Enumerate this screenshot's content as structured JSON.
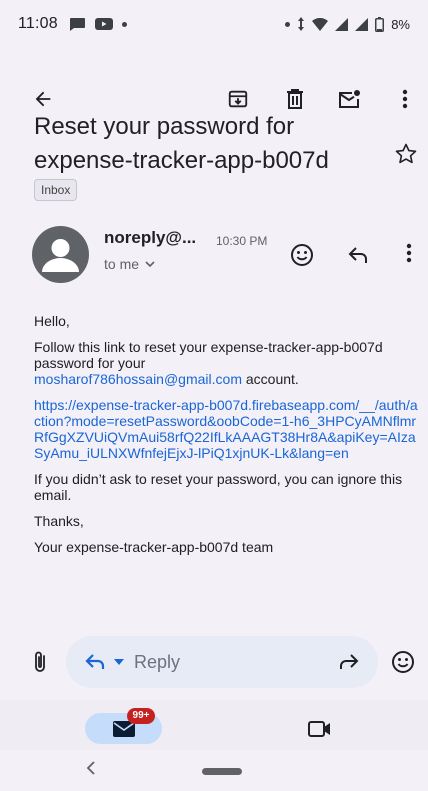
{
  "status_bar": {
    "time": "11:08",
    "battery": "8%",
    "icons": [
      "chat-bubble-icon",
      "youtube-icon",
      "dot-icon",
      "dot-icon",
      "data-arrows-icon",
      "wifi-icon",
      "signal-icon",
      "signal-icon",
      "battery-icon"
    ]
  },
  "toolbar": {
    "icons": [
      "back-arrow-icon",
      "archive-icon",
      "delete-icon",
      "mark-unread-icon",
      "more-vert-icon"
    ]
  },
  "email": {
    "subject": "Reset your password for expense-tracker-app-b007d",
    "label": "Inbox",
    "sender": "noreply@...",
    "time": "10:30 PM",
    "to": "to me",
    "greeting": "Hello,",
    "para1": "Follow this link to reset your expense-tracker-app-b007d password for your",
    "email_address": "mosharof786hossain@gmail.com",
    "para1_end": " account.",
    "reset_link": "https://expense-tracker-app-b007d.firebaseapp.com/__/auth/action?mode=resetPassword&oobCode=1-h6_3HPCyAMNflmrRfGgXZVUiQVmAui58rfQ22IfLkAAAGT38Hr8A&apiKey=AIzaSyAmu_iULNXWfnfejEjxJ-lPiQ1xjnUK-Lk&lang=en",
    "para2": "If you didn’t ask to reset your password, you can ignore this email.",
    "thanks": "Thanks,",
    "signature": "Your expense-tracker-app-b007d team"
  },
  "reply_bar": {
    "reply_label": "Reply"
  },
  "bottom_nav": {
    "mail_badge": "99+"
  },
  "colors": {
    "background": "#f3f0f7",
    "link": "#1a66d6",
    "reply_pill": "#e6ebf5",
    "mail_pill": "#c5dcfa",
    "badge": "#c5221f"
  }
}
